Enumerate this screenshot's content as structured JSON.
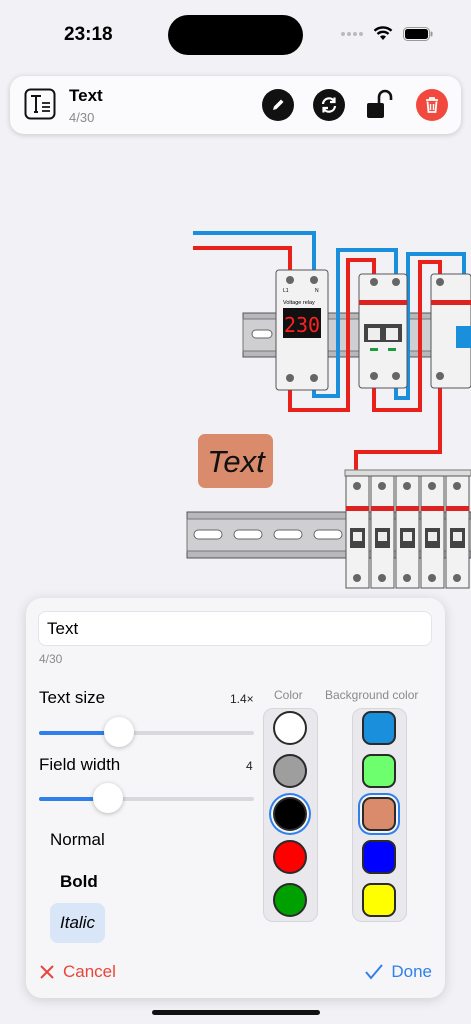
{
  "status": {
    "time": "23:18"
  },
  "toolbar": {
    "title": "Text",
    "count": "4/30",
    "icons": [
      "text-tool-icon",
      "pencil-icon",
      "sync-icon",
      "unlock-icon",
      "trash-icon"
    ]
  },
  "canvas": {
    "label_text": "Text",
    "relay_display": "230",
    "relay_title": "Voltage relay",
    "relay_terminals": [
      "L1",
      "N"
    ]
  },
  "editor": {
    "text_value": "Text",
    "char_count": "4/30",
    "text_size_label": "Text size",
    "text_size_value": "1.4×",
    "text_size_fraction": 0.37,
    "field_width_label": "Field width",
    "field_width_value": "4",
    "field_width_fraction": 0.32,
    "styles": [
      "Normal",
      "Bold",
      "Italic"
    ],
    "selected_style": "Italic",
    "color_header": "Color",
    "bg_color_header": "Background color",
    "colors": [
      "#ffffff",
      "#9e9e9e",
      "#000000",
      "#ff0000",
      "#00a000"
    ],
    "selected_color": "#000000",
    "bg_colors": [
      "#1a8fdc",
      "#6dff6d",
      "#d98b6c",
      "#0000ff",
      "#ffff00"
    ],
    "selected_bg_color": "#d98b6c",
    "cancel_label": "Cancel",
    "done_label": "Done"
  }
}
